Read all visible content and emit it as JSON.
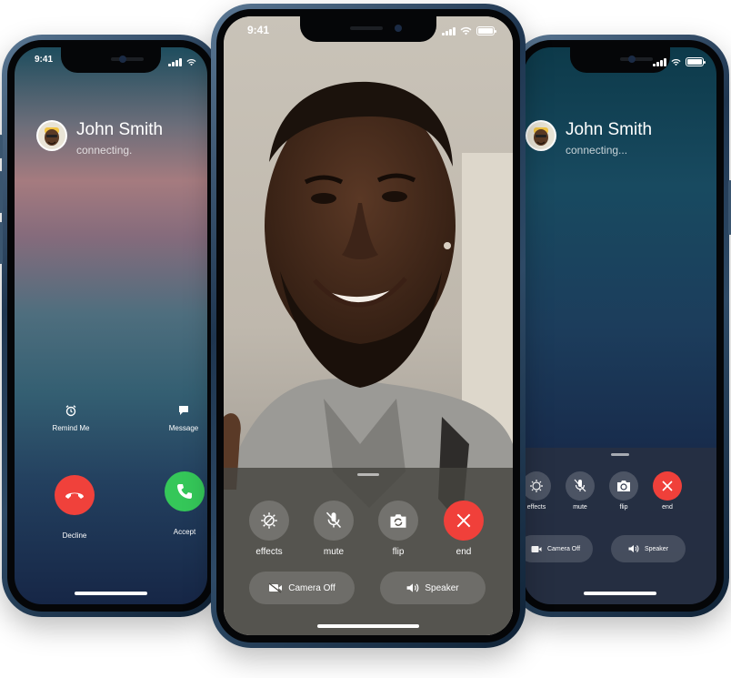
{
  "status_bar": {
    "time": "9:41"
  },
  "left_phone": {
    "caller_name": "John Smith",
    "caller_status": "connecting.",
    "remind_label": "Remind Me",
    "message_label": "Message",
    "decline_label": "Decline",
    "accept_label": "Accept"
  },
  "center_phone": {
    "controls": {
      "effects": "effects",
      "mute": "mute",
      "flip": "flip",
      "end": "end"
    },
    "camera_off": "Camera Off",
    "speaker": "Speaker"
  },
  "right_phone": {
    "caller_name": "John Smith",
    "caller_status": "connecting...",
    "controls": {
      "effects": "effects",
      "mute": "mute",
      "flip": "flip",
      "end": "end"
    },
    "camera_off": "Camera Off",
    "speaker": "Speaker"
  },
  "colors": {
    "decline": "#f0413b",
    "accept": "#35c759",
    "end": "#f0403a"
  },
  "icons": [
    "alarm-icon",
    "message-icon",
    "phone-down-icon",
    "phone-icon",
    "effects-icon",
    "mute-icon",
    "flip-camera-icon",
    "close-icon",
    "camera-off-icon",
    "speaker-icon",
    "avatar-memoji-icon"
  ]
}
